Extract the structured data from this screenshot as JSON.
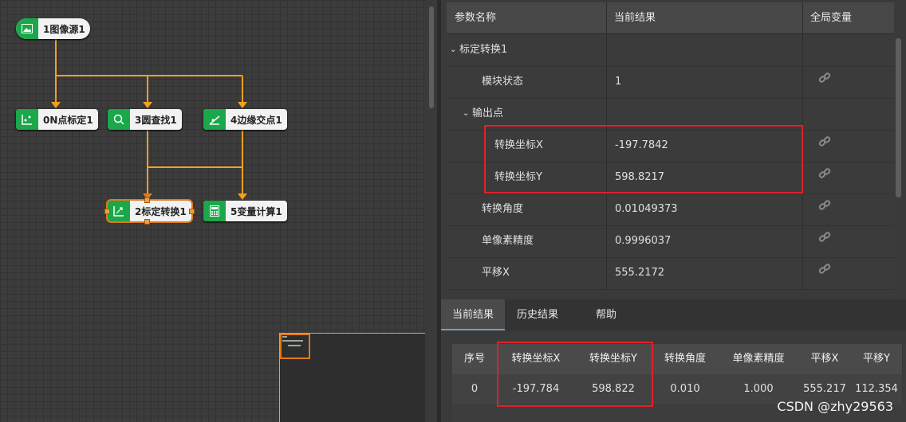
{
  "flow": {
    "nodes": {
      "source": "1图像源1",
      "calib_n": "0N点标定1",
      "circle": "3圆查找1",
      "edge": "4边缘交点1",
      "transform": "2标定转换1",
      "calc": "5变量计算1"
    }
  },
  "params": {
    "headers": {
      "name": "参数名称",
      "result": "当前结果",
      "global": "全局变量"
    },
    "rows": [
      {
        "name": "标定转换1",
        "value": "",
        "group": true
      },
      {
        "name": "模块状态",
        "value": "1"
      },
      {
        "name": "输出点",
        "value": "",
        "group": true
      },
      {
        "name": "转换坐标X",
        "value": "-197.7842"
      },
      {
        "name": "转换坐标Y",
        "value": "598.8217"
      },
      {
        "name": "转换角度",
        "value": "0.01049373"
      },
      {
        "name": "单像素精度",
        "value": "0.9996037"
      },
      {
        "name": "平移X",
        "value": "555.2172"
      }
    ]
  },
  "tabs": {
    "current": "当前结果",
    "history": "历史结果",
    "help": "帮助"
  },
  "results": {
    "headers": [
      "序号",
      "转换坐标X",
      "转换坐标Y",
      "转换角度",
      "单像素精度",
      "平移X",
      "平移Y"
    ],
    "row": [
      "0",
      "-197.784",
      "598.822",
      "0.010",
      "1.000",
      "555.217",
      "112.354"
    ]
  },
  "watermark": "CSDN @zhy29563",
  "colors": {
    "accent_green": "#1aa84a",
    "connector": "#f0a020",
    "highlight": "#e0202a",
    "selected": "#e07a1a"
  }
}
